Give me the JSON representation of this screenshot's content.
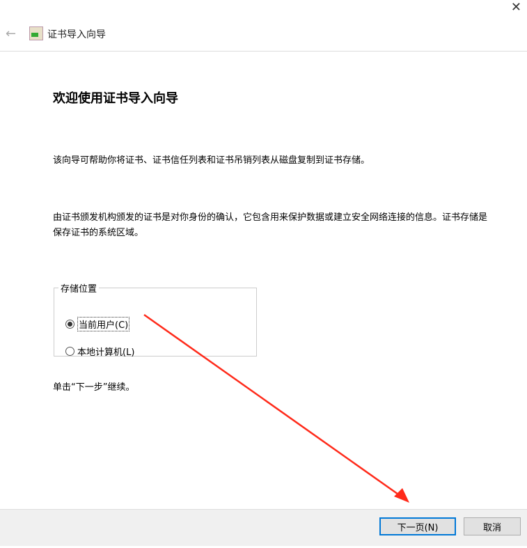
{
  "window": {
    "title": "证书导入向导",
    "close": "✕",
    "back": "←"
  },
  "main": {
    "heading": "欢迎使用证书导入向导",
    "para1": "该向导可帮助你将证书、证书信任列表和证书吊销列表从磁盘复制到证书存储。",
    "para2": "由证书颁发机构颁发的证书是对你身份的确认，它包含用来保护数据或建立安全网络连接的信息。证书存储是保存证书的系统区域。",
    "store": {
      "legend": "存储位置",
      "options": [
        {
          "label": "当前用户(C)",
          "selected": true
        },
        {
          "label": "本地计算机(L)",
          "selected": false
        }
      ]
    },
    "continue": "单击“下一步”继续。"
  },
  "footer": {
    "next": "下一页(N)",
    "cancel": "取消"
  },
  "annotation": {
    "arrow_color": "#ff2a1a"
  }
}
